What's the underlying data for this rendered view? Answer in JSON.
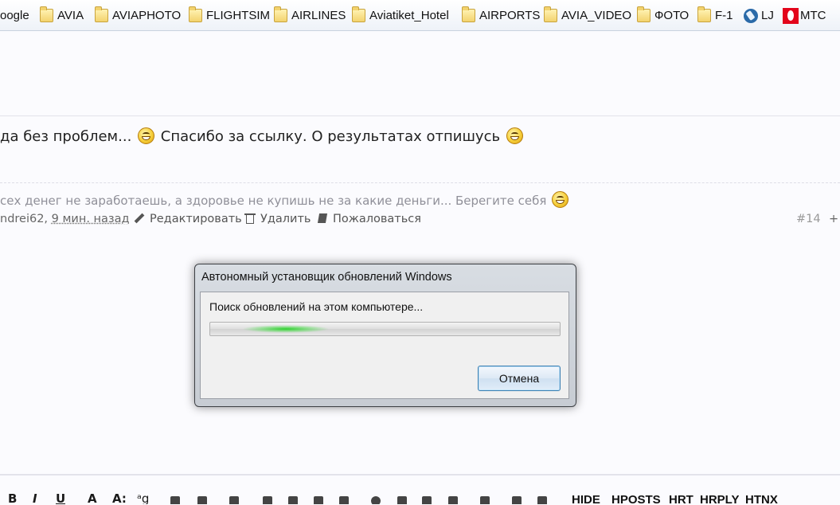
{
  "bookmarks": [
    {
      "label": "oogle",
      "icon": "google-favicon"
    },
    {
      "label": "AVIA",
      "icon": "folder-icon"
    },
    {
      "label": "AVIAPHOTO",
      "icon": "folder-icon"
    },
    {
      "label": "FLIGHTSIM",
      "icon": "folder-icon"
    },
    {
      "label": "AIRLINES",
      "icon": "folder-icon"
    },
    {
      "label": "Aviatiket_Hotel",
      "icon": "folder-icon"
    },
    {
      "label": "AIRPORTS",
      "icon": "folder-icon"
    },
    {
      "label": "AVIA_VIDEO",
      "icon": "folder-icon"
    },
    {
      "label": "ФОТО",
      "icon": "folder-icon"
    },
    {
      "label": "F-1",
      "icon": "folder-icon"
    },
    {
      "label": "LJ",
      "icon": "lj-favicon"
    },
    {
      "label": "МТС",
      "icon": "mts-favicon"
    }
  ],
  "post": {
    "text_part1": "да без проблем...",
    "text_part2": "Спасибо за ссылку. О результатах отпишусь",
    "signature": "сех денег не заработаешь, а здоровье не купишь не за какие деньги... Берегите себя",
    "author": "ndrei62,",
    "time": "9 мин. назад",
    "actions": {
      "edit": "Редактировать",
      "delete": "Удалить",
      "report": "Пожаловаться"
    },
    "number": "#14",
    "plus": "+"
  },
  "dialog": {
    "title": "Автономный установщик обновлений Windows",
    "status": "Поиск обновлений на этом компьютере...",
    "cancel_label": "Отмена",
    "progress_state": "indeterminate",
    "progress_color": "#2fd12f"
  },
  "toolbar": {
    "format_icons": [
      "bold-icon",
      "italic-icon",
      "underline-icon",
      "font-color-icon",
      "font-size-icon",
      "font-face-icon",
      "link-icon",
      "unlink-icon",
      "align-icon",
      "bullet-list-icon",
      "numbered-list-icon",
      "outdent-icon",
      "indent-icon",
      "smiley-icon",
      "image-icon",
      "gallery-icon",
      "quote-icon",
      "save-icon",
      "undo-icon",
      "redo-icon"
    ],
    "labels": {
      "bold": "B",
      "italic": "I",
      "underline": "U",
      "color": "A",
      "size": "A:",
      "face": "ᵃg",
      "hide": "HIDE",
      "hposts": "HPOSTS",
      "hrt": "HRT",
      "hrply": "HRPLY",
      "htnx": "HTNX"
    }
  }
}
